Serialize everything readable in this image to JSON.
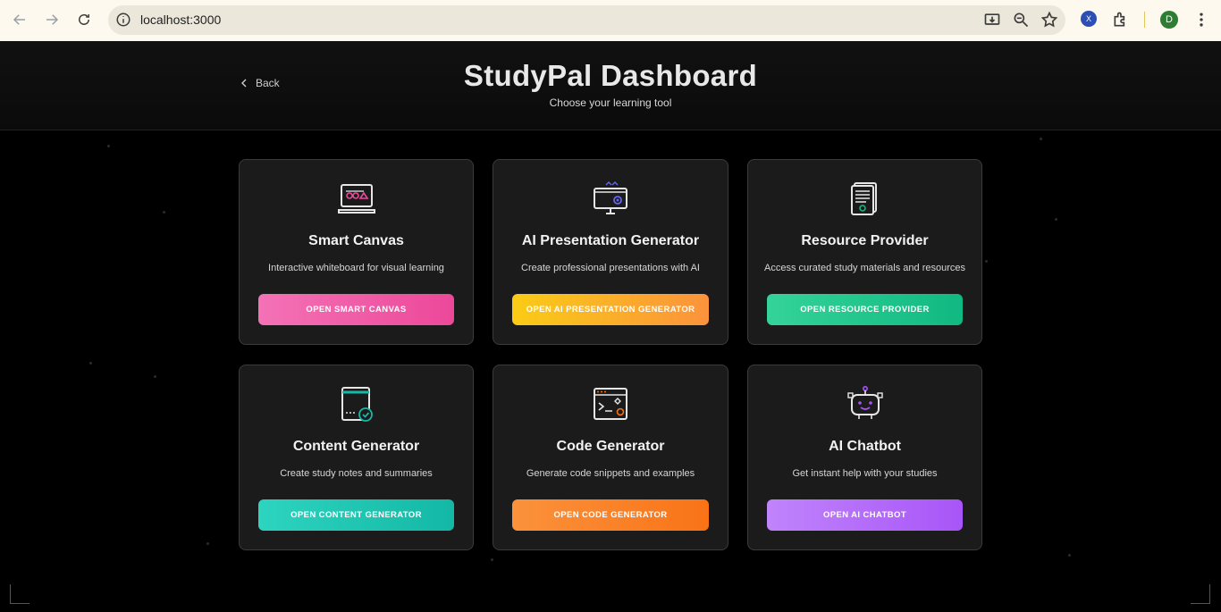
{
  "browser": {
    "url": "localhost:3000",
    "extension_badge": "X",
    "profile_initial": "D"
  },
  "header": {
    "back_label": "Back",
    "title": "StudyPal Dashboard",
    "subtitle": "Choose your learning tool"
  },
  "cards": [
    {
      "title": "Smart Canvas",
      "description": "Interactive whiteboard for visual learning",
      "button": "OPEN SMART CANVAS",
      "icon": "whiteboard-icon",
      "color_from": "#f472b6",
      "color_to": "#ec4899"
    },
    {
      "title": "AI Presentation Generator",
      "description": "Create professional presentations with AI",
      "button": "OPEN AI PRESENTATION GENERATOR",
      "icon": "presentation-icon",
      "color_from": "#facc15",
      "color_to": "#fb923c"
    },
    {
      "title": "Resource Provider",
      "description": "Access curated study materials and resources",
      "button": "OPEN RESOURCE PROVIDER",
      "icon": "documents-icon",
      "color_from": "#34d399",
      "color_to": "#10b981"
    },
    {
      "title": "Content Generator",
      "description": "Create study notes and summaries",
      "button": "OPEN CONTENT GENERATOR",
      "icon": "content-icon",
      "color_from": "#2dd4bf",
      "color_to": "#14b8a6"
    },
    {
      "title": "Code Generator",
      "description": "Generate code snippets and examples",
      "button": "OPEN CODE GENERATOR",
      "icon": "code-icon",
      "color_from": "#fb923c",
      "color_to": "#f97316"
    },
    {
      "title": "AI Chatbot",
      "description": "Get instant help with your studies",
      "button": "OPEN AI CHATBOT",
      "icon": "robot-icon",
      "color_from": "#c084fc",
      "color_to": "#a855f7"
    }
  ]
}
